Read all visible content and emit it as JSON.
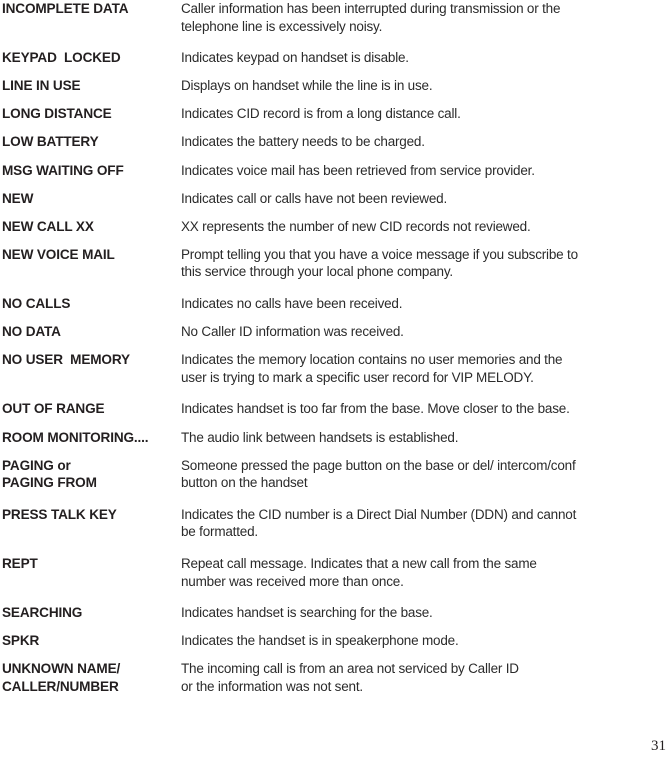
{
  "page": {
    "number": "31"
  },
  "glossary": {
    "rows": [
      {
        "term": "INCOMPLETE DATA",
        "lines": [
          "Caller information has been interrupted during transmission or the",
          "telephone line is excessively noisy."
        ]
      },
      {
        "term": "KEYPAD  LOCKED",
        "lines": [
          "Indicates keypad on handset is disable."
        ]
      },
      {
        "term": "LINE IN USE",
        "lines": [
          "Displays on handset while the line is in use."
        ]
      },
      {
        "term": "LONG DISTANCE",
        "lines": [
          "Indicates CID record is from a long distance call."
        ]
      },
      {
        "term": "LOW BATTERY",
        "lines": [
          "Indicates the battery needs to be charged."
        ]
      },
      {
        "term": "MSG WAITING OFF",
        "lines": [
          "Indicates voice mail has been retrieved from service provider."
        ]
      },
      {
        "term": "NEW",
        "lines": [
          "Indicates call or calls have not been reviewed."
        ]
      },
      {
        "term": "NEW CALL XX",
        "lines": [
          "XX represents the number of new CID records not reviewed."
        ]
      },
      {
        "term": "NEW VOICE MAIL",
        "lines": [
          "Prompt telling you that you have a voice message if you subscribe to",
          "this service through your local phone company."
        ]
      },
      {
        "term": "NO CALLS",
        "lines": [
          "Indicates no calls have been received."
        ]
      },
      {
        "term": "NO DATA",
        "lines": [
          "No Caller ID information was received."
        ]
      },
      {
        "term": "NO USER  MEMORY",
        "lines": [
          "Indicates the memory location contains no user memories and the",
          "user is trying to mark a specific user record for VIP MELODY."
        ]
      },
      {
        "term": "OUT OF RANGE",
        "lines": [
          "Indicates handset is too far from the base. Move closer to the base."
        ]
      },
      {
        "term": "ROOM MONITORING....",
        "lines": [
          "The audio link between handsets is established."
        ]
      },
      {
        "term_lines": [
          "PAGING or",
          "PAGING FROM"
        ],
        "lines": [
          "Someone pressed the page button on the base or del/ intercom/conf",
          "button on the handset"
        ]
      },
      {
        "term": "PRESS TALK KEY",
        "lines": [
          "Indicates the CID number is a Direct Dial Number (DDN) and cannot",
          "be formatted."
        ]
      },
      {
        "term": "REPT",
        "lines": [
          "Repeat call message. Indicates that a new call from the same",
          "number was received more than once."
        ]
      },
      {
        "term": "SEARCHING",
        "lines": [
          "Indicates handset is searching for the base."
        ]
      },
      {
        "term": "SPKR",
        "lines": [
          "Indicates the handset is in speakerphone mode."
        ]
      },
      {
        "term_lines": [
          "UNKNOWN NAME/",
          "CALLER/NUMBER"
        ],
        "lines": [
          "The incoming call is from an area not serviced by Caller ID",
          "or the information was not sent."
        ]
      }
    ]
  }
}
